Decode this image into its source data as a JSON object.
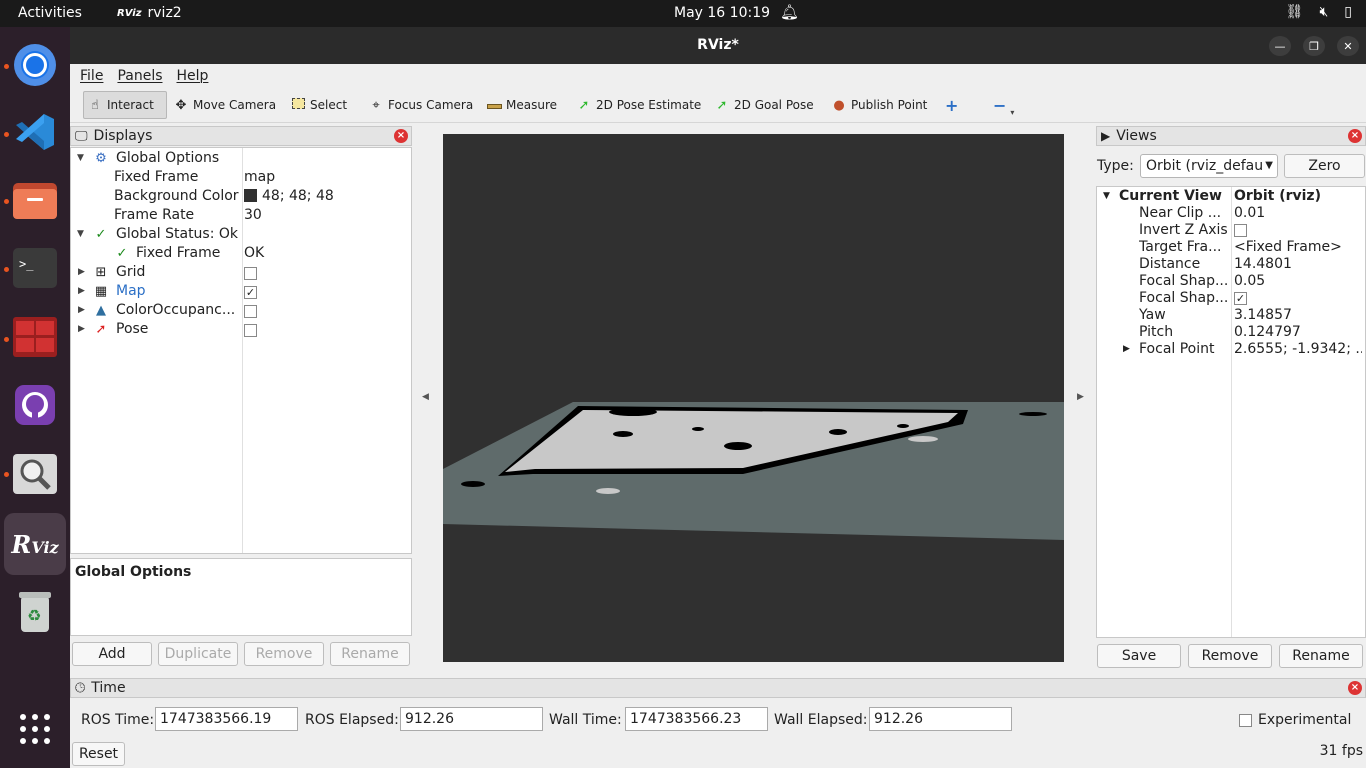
{
  "topbar": {
    "activities": "Activities",
    "app_name": "rviz2",
    "clock": "May 16  10:19"
  },
  "dock": {
    "items": [
      "chrome-icon",
      "vscode-icon",
      "files-icon",
      "terminal-icon",
      "terminator-icon",
      "github-icon",
      "image-viewer-icon",
      "rviz-icon",
      "trash-icon",
      "app-grid-icon"
    ]
  },
  "window": {
    "title": "RViz*"
  },
  "menu": [
    "File",
    "Panels",
    "Help"
  ],
  "toolbar": {
    "interact": "Interact",
    "move_camera": "Move Camera",
    "select": "Select",
    "focus_camera": "Focus Camera",
    "measure": "Measure",
    "pose_estimate": "2D Pose Estimate",
    "goal_pose": "2D Goal Pose",
    "publish_point": "Publish Point",
    "add_tool": "+",
    "remove_tool": "−"
  },
  "displays": {
    "title": "Displays",
    "rows": {
      "global_options": "Global Options",
      "fixed_frame_label": "Fixed Frame",
      "fixed_frame_value": "map",
      "background_color_label": "Background Color",
      "background_color_value": "48; 48; 48",
      "frame_rate_label": "Frame Rate",
      "frame_rate_value": "30",
      "global_status": "Global Status: Ok",
      "status_fixed_frame": "Fixed Frame",
      "status_fixed_frame_value": "OK",
      "grid": "Grid",
      "map": "Map",
      "color_occupancy": "ColorOccupanc...",
      "pose": "Pose"
    },
    "checks": {
      "grid": false,
      "map": true,
      "color_occupancy": false,
      "pose": false
    },
    "description_title": "Global Options",
    "buttons": {
      "add": "Add",
      "duplicate": "Duplicate",
      "remove": "Remove",
      "rename": "Rename"
    }
  },
  "views": {
    "title": "Views",
    "type_label": "Type:",
    "type_value": "Orbit (rviz_defau",
    "zero": "Zero",
    "current_view_label": "Current View",
    "current_view_value": "Orbit (rviz)",
    "props": [
      {
        "label": "Near Clip ...",
        "value": "0.01"
      },
      {
        "label": "Invert Z Axis",
        "value": ""
      },
      {
        "label": "Target Fra...",
        "value": "<Fixed Frame>"
      },
      {
        "label": "Distance",
        "value": "14.4801"
      },
      {
        "label": "Focal Shap...",
        "value": "0.05"
      },
      {
        "label": "Focal Shap...",
        "value": ""
      },
      {
        "label": "Yaw",
        "value": "3.14857"
      },
      {
        "label": "Pitch",
        "value": "0.124797"
      },
      {
        "label": "Focal Point",
        "value": "2.6555; -1.9342; ..."
      }
    ],
    "buttons": {
      "save": "Save",
      "remove": "Remove",
      "rename": "Rename"
    }
  },
  "time": {
    "title": "Time",
    "ros_time_label": "ROS Time:",
    "ros_time_value": "1747383566.19",
    "ros_elapsed_label": "ROS Elapsed:",
    "ros_elapsed_value": "912.26",
    "wall_time_label": "Wall Time:",
    "wall_time_value": "1747383566.23",
    "wall_elapsed_label": "Wall Elapsed:",
    "wall_elapsed_value": "912.26",
    "experimental": "Experimental",
    "reset": "Reset",
    "fps": "31 fps"
  },
  "colors": {
    "view_background": "#303030",
    "ground_plane": "#5f6b6b",
    "map_free": "#c8c8c8",
    "map_occupied": "#000000",
    "link_blue": "#2b6fc6"
  }
}
